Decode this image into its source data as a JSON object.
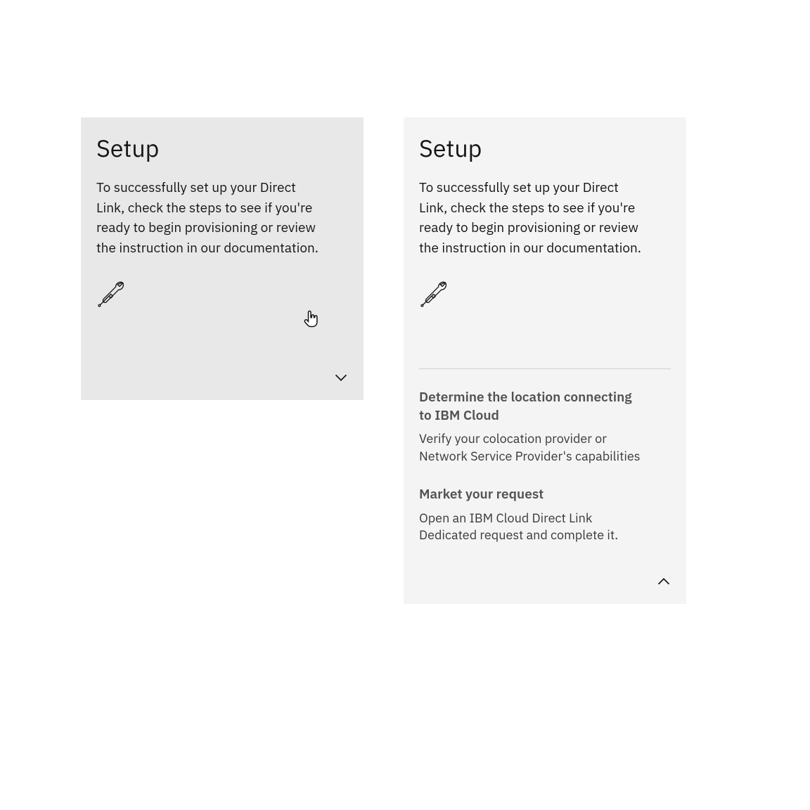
{
  "cards": {
    "left": {
      "title": "Setup",
      "desc": "To successfully set up your Direct Link, check the steps to see if you're ready to begin provisioning or review the instruction in our documentation.",
      "expanded": false
    },
    "right": {
      "title": "Setup",
      "desc": "To successfully set up your Direct Link, check the steps to see if you're ready to begin provisioning or review the instruction in our documentation.",
      "expanded": true,
      "steps": [
        {
          "title": "Determine the location connecting to IBM Cloud",
          "body": "Verify your colocation provider or Network Service Provider's capabilities"
        },
        {
          "title": "Market your request",
          "body": "Open an IBM Cloud Direct Link Dedicated request and complete it."
        }
      ]
    }
  }
}
